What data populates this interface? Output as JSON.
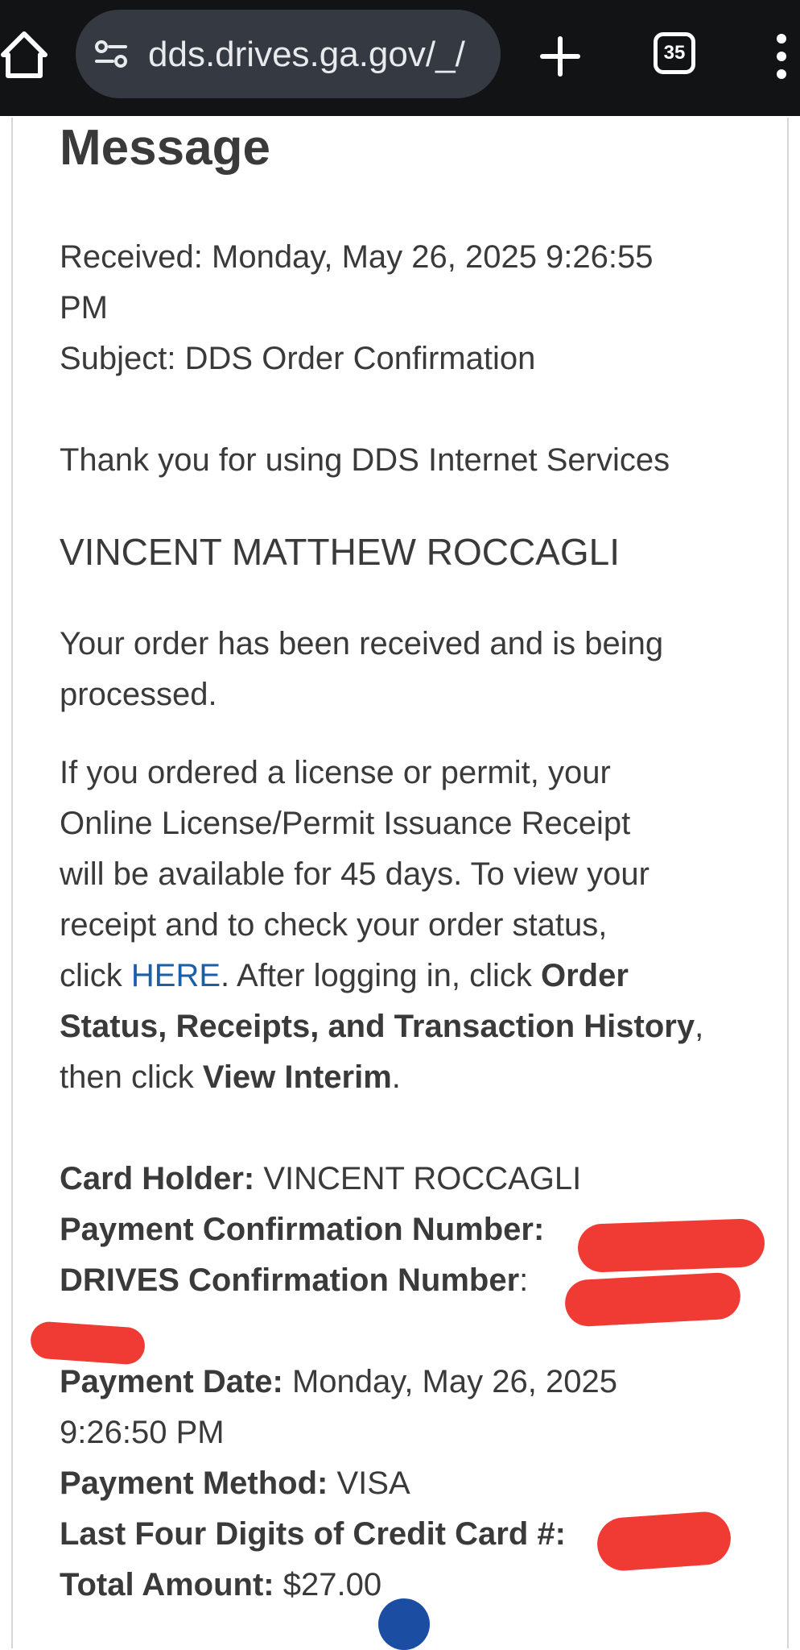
{
  "browser": {
    "url": "dds.drives.ga.gov/_/",
    "tab_count": "35"
  },
  "message": {
    "heading": "Message",
    "received_label": "Received:",
    "received_value": "Monday, May 26, 2025 9:26:55",
    "received_value_cont": "PM",
    "subject_label": "Subject:",
    "subject_value": "DDS Order Confirmation",
    "thanks": "Thank you for using DDS Internet Services",
    "customer_name": "VINCENT MATTHEW ROCCAGLI",
    "order_status_line1": "Your order has been received and is being",
    "order_status_line2": "processed.",
    "info_line1": "If you ordered a license or permit, your",
    "info_line2": "Online License/Permit Issuance Receipt",
    "info_line3": "will be available for 45 days. To view your",
    "info_line4": "receipt and to check your order status,",
    "info_click": "click ",
    "info_here_link": "HERE",
    "info_after_link": ". After logging in, click ",
    "info_bold_order": "Order",
    "info_bold_status": "Status, Receipts, and Transaction History",
    "info_comma": ",",
    "info_then": "then click ",
    "info_bold_view": "View Interim",
    "info_period": "."
  },
  "payment": {
    "card_holder_label": "Card Holder:",
    "card_holder_value": " VINCENT ROCCAGLI",
    "payment_conf_label": "Payment Confirmation Number:",
    "drives_conf_label": "DRIVES Confirmation Number",
    "drives_conf_colon": ":",
    "payment_date_label": "Payment Date:",
    "payment_date_value": " Monday, May 26, 2025",
    "payment_date_time": "9:26:50 PM",
    "payment_method_label": "Payment Method:",
    "payment_method_value": " VISA",
    "last_four_label": "Last Four Digits of Credit Card #:",
    "total_label": "Total Amount:",
    "total_value": " $27.00"
  },
  "colors": {
    "topbar": "#121314",
    "url_pill": "#353a42",
    "link": "#1a5fa8",
    "redaction": "#f03a34"
  }
}
